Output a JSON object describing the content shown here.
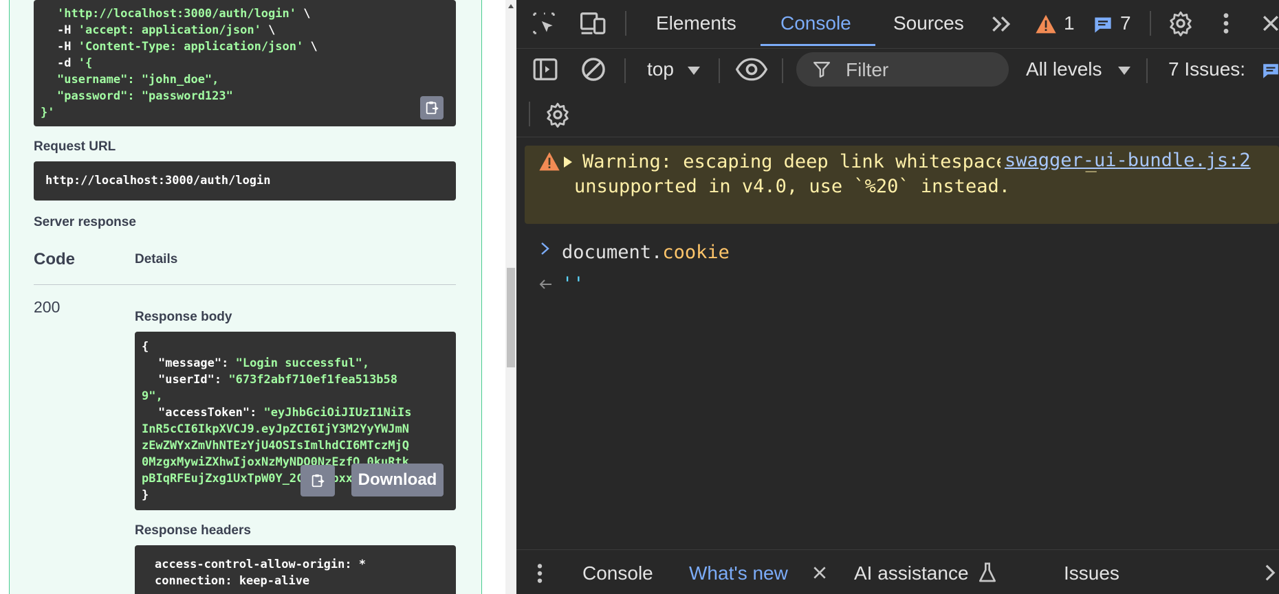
{
  "swagger": {
    "curl_lines": [
      {
        "green": "'http://localhost:3000/auth/login'",
        "white": " \\"
      },
      {
        "white_pre": "-H ",
        "green": "'accept: application/json'",
        "white": " \\"
      },
      {
        "white_pre": "-H ",
        "green": "'Content-Type: application/json'",
        "white": " \\"
      },
      {
        "white_pre": "-d ",
        "green": "'{"
      },
      {
        "green": "\"username\": \"john_doe\","
      },
      {
        "green": "\"password\": \"password123\""
      },
      {
        "green": "}'"
      }
    ],
    "request_url_label": "Request URL",
    "request_url": "http://localhost:3000/auth/login",
    "server_response_label": "Server response",
    "code_header": "Code",
    "details_header": "Details",
    "response_code": "200",
    "response_body_label": "Response body",
    "response_body": {
      "open": "{",
      "message_key": "\"message\"",
      "message_val": "\"Login successful\",",
      "userid_key": "\"userId\"",
      "userid_val1": "\"673f2abf710ef1fea513b58",
      "userid_val2": "9\",",
      "token_key": "\"accessToken\"",
      "token_val1": "\"eyJhbGciOiJIUzI1NiIs",
      "token_lines": [
        "InR5cCI6IkpXVCJ9.eyJpZCI6IjY3M2YyYWJmN",
        "zEwZWYxZmVhNTEzYjU4OSIsImlhdCI6MTczMjQ",
        "0MzgxMywiZXhwIjoxNzMyNDQ0NzEzfQ.0kuRtk",
        "pBIqRFEujZxg1UxTpW0Y_2CgVzNbxxu6Ssu3Bk"
      ],
      "close": "}"
    },
    "download_label": "Download",
    "response_headers_label": "Response headers",
    "response_headers": [
      "access-control-allow-origin: *",
      "connection: keep-alive"
    ]
  },
  "devtools": {
    "tabs": [
      "Elements",
      "Console",
      "Sources"
    ],
    "active_tab": "Console",
    "warning_count": "1",
    "message_count": "7",
    "context": "top",
    "filter_placeholder": "Filter",
    "levels": "All levels",
    "issues_label": "7 Issues:",
    "warning": {
      "text": "Warning: escaping deep link whitespace with `_` will be unsupported in v4.0, use `%20` instead.",
      "source": "swagger-ui-bundle.js:2"
    },
    "input": {
      "object": "document",
      "dot": ".",
      "property": "cookie"
    },
    "output": "''",
    "drawer_tabs": {
      "console": "Console",
      "whats_new": "What's new",
      "ai": "AI assistance",
      "issues": "Issues"
    },
    "colors": {
      "accent": "#7cacf8",
      "warning_bg": "#413c26",
      "warning_icon": "#f28b54",
      "swagger_green": "#49cc90"
    }
  }
}
